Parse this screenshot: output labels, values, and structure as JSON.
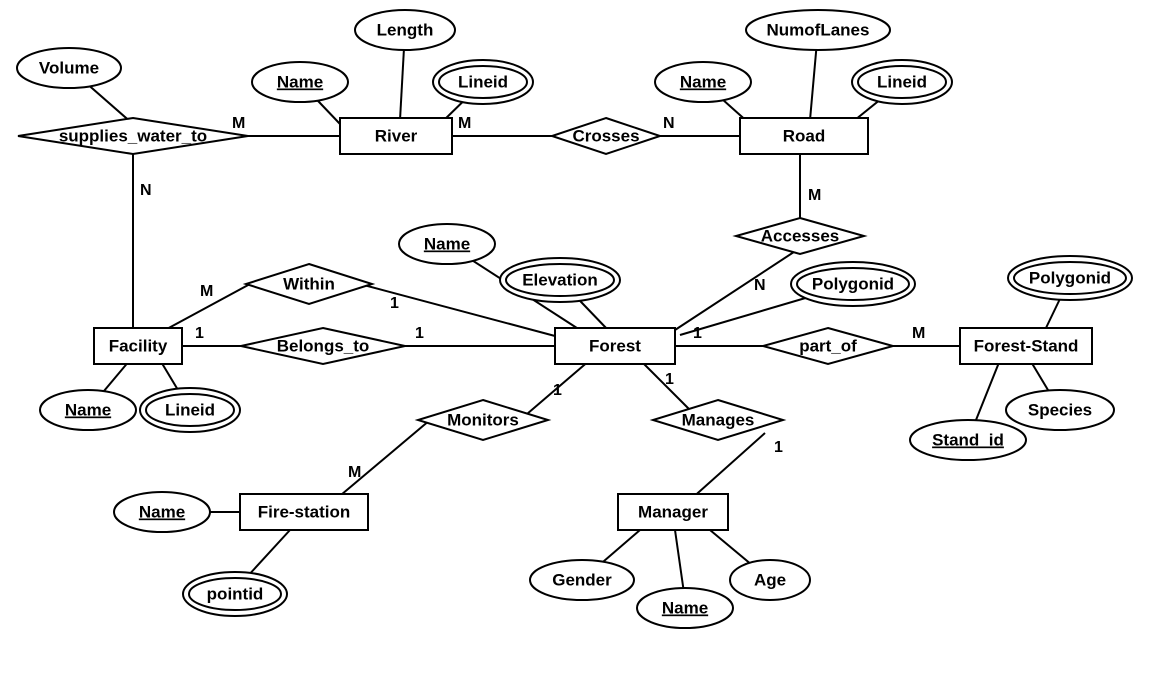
{
  "entities": {
    "river": "River",
    "road": "Road",
    "facility": "Facility",
    "forest": "Forest",
    "forest_stand": "Forest-Stand",
    "fire_station": "Fire-station",
    "manager": "Manager"
  },
  "relationships": {
    "supplies_water_to": "supplies_water_to",
    "crosses": "Crosses",
    "accesses": "Accesses",
    "within": "Within",
    "belongs_to": "Belongs_to",
    "part_of": "part_of",
    "monitors": "Monitors",
    "manages": "Manages"
  },
  "attributes": {
    "volume": "Volume",
    "length": "Length",
    "river_name": "Name",
    "river_lineid": "Lineid",
    "num_of_lanes": "NumofLanes",
    "road_name": "Name",
    "road_lineid": "Lineid",
    "forest_name": "Name",
    "elevation": "Elevation",
    "forest_polygonid": "Polygonid",
    "facility_name": "Name",
    "facility_lineid": "Lineid",
    "fs_name": "Name",
    "fs_pointid": "pointid",
    "gender": "Gender",
    "manager_name": "Name",
    "age": "Age",
    "stand_polygonid": "Polygonid",
    "species": "Species",
    "stand_id": "Stand_id"
  },
  "cardinalities": {
    "supplies_river": "M",
    "supplies_facility": "N",
    "crosses_river": "M",
    "crosses_road": "N",
    "accesses_road": "M",
    "accesses_forest": "N",
    "within_facility": "M",
    "within_forest": "1",
    "belongs_facility": "1",
    "belongs_forest": "1",
    "partof_forest": "1",
    "partof_stand": "M",
    "monitors_forest": "1",
    "monitors_fire": "M",
    "manages_forest": "1",
    "manages_manager": "1"
  }
}
